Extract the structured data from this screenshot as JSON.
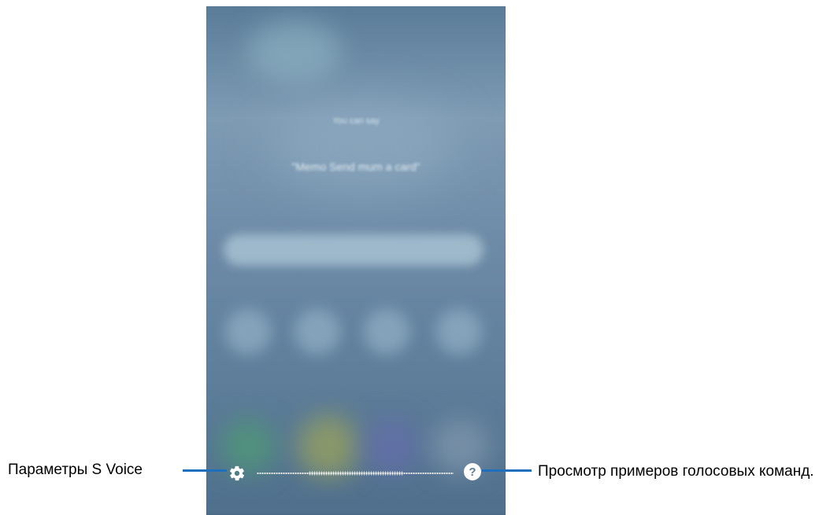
{
  "screen": {
    "hint_small": "You can say",
    "hint_example": "\"Memo Send mum a card\""
  },
  "bottom_bar": {
    "help_symbol": "?"
  },
  "callouts": {
    "settings": "Параметры S Voice",
    "examples": "Просмотр примеров голосовых команд."
  },
  "colors": {
    "callout_line": "#1f6fbf",
    "screen_bg": "#6c8aa6"
  }
}
